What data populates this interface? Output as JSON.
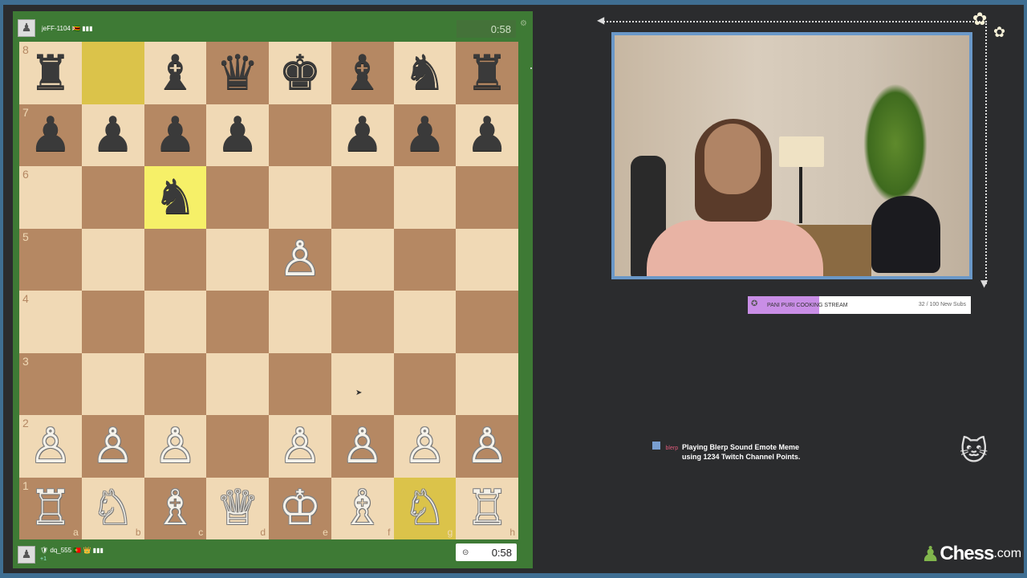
{
  "top_player": {
    "name": "jeFF-1104 🇿🇼 ▮▮▮",
    "clock": "0:58",
    "avatar": "pawn-avatar-icon"
  },
  "bottom_player": {
    "name": "🛡 dq_555 🇵🇹 👑 ▮▮▮",
    "rating_change": "+1",
    "clock": "0:58",
    "avatar": "pawn-avatar-icon"
  },
  "board": {
    "ranks": [
      "8",
      "7",
      "6",
      "5",
      "4",
      "3",
      "2",
      "1"
    ],
    "files": [
      "a",
      "b",
      "c",
      "d",
      "e",
      "f",
      "g",
      "h"
    ],
    "pieces": {
      "a8": "♜",
      "c8": "♝",
      "d8": "♛",
      "e8": "♚",
      "f8": "♝",
      "g8": "♞",
      "h8": "♜",
      "a7": "♟",
      "b7": "♟",
      "c7": "♟",
      "d7": "♟",
      "f7": "♟",
      "g7": "♟",
      "h7": "♟",
      "c6": "♞",
      "e5": "♙",
      "a2": "♙",
      "b2": "♙",
      "c2": "♙",
      "e2": "♙",
      "f2": "♙",
      "g2": "♙",
      "h2": "♙",
      "a1": "♖",
      "b1": "♘",
      "c1": "♗",
      "d1": "♕",
      "e1": "♔",
      "f1": "♗",
      "g1": "♘",
      "h1": "♖"
    },
    "highlighted": [
      "b8",
      "c6",
      "g1"
    ]
  },
  "goal": {
    "title": "PANI PURI COOKING STREAM",
    "count": "32 / 100 New Subs",
    "progress": 0.32,
    "color": "#c98ee6"
  },
  "alert": {
    "user": "blerp",
    "line1": "Playing Blerp Sound Emote Meme",
    "line2": "using 1234 Twitch Channel Points."
  },
  "brand": {
    "name": "Chess",
    "tld": ".com"
  },
  "colors": {
    "board_light": "#f0d9b5",
    "board_dark": "#b58863",
    "frame": "#3f6e92",
    "panel_green": "#3e7a35"
  }
}
